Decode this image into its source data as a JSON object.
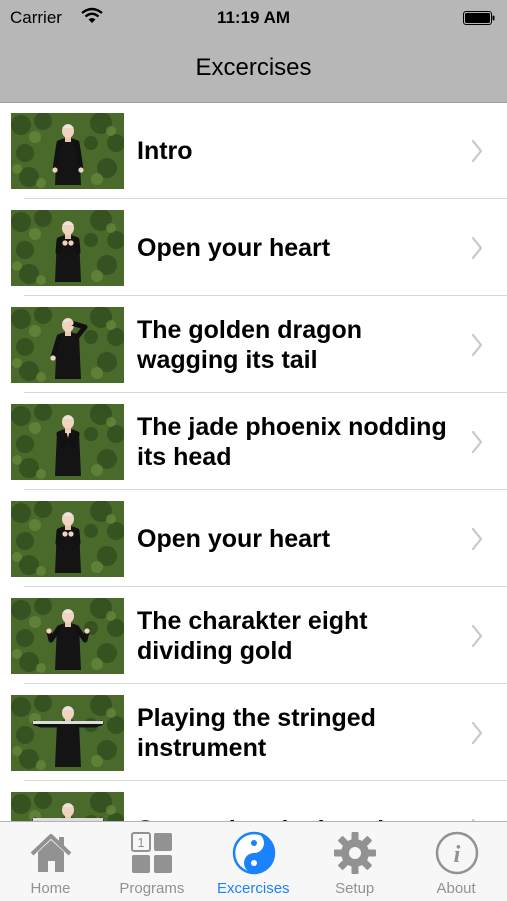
{
  "status_bar": {
    "carrier": "Carrier",
    "time": "11:19 AM"
  },
  "nav": {
    "title": "Excercises"
  },
  "exercises": [
    {
      "label": "Intro",
      "pose": "arms-down"
    },
    {
      "label": "Open your heart",
      "pose": "hands-chest"
    },
    {
      "label": "The golden dragon wagging its tail",
      "pose": "arm-raised"
    },
    {
      "label": "The jade phoenix nodding its head",
      "pose": "hands-prayer"
    },
    {
      "label": "Open your heart",
      "pose": "hands-chest"
    },
    {
      "label": "The charakter eight dividing gold",
      "pose": "hands-wide"
    },
    {
      "label": "Playing the stringed instrument",
      "pose": "arms-out"
    },
    {
      "label": "Separating the begging",
      "pose": "arms-out"
    }
  ],
  "tabs": [
    {
      "label": "Home",
      "icon": "home-icon",
      "active": false
    },
    {
      "label": "Programs",
      "icon": "programs-icon",
      "active": false
    },
    {
      "label": "Excercises",
      "icon": "yin-yang-icon",
      "active": true
    },
    {
      "label": "Setup",
      "icon": "gear-icon",
      "active": false
    },
    {
      "label": "About",
      "icon": "info-icon",
      "active": false
    }
  ],
  "colors": {
    "bar_gray": "#b7b7b7",
    "tab_active": "#1a82fb",
    "tab_inactive": "#929292",
    "hedge": "#4a6a2c"
  }
}
